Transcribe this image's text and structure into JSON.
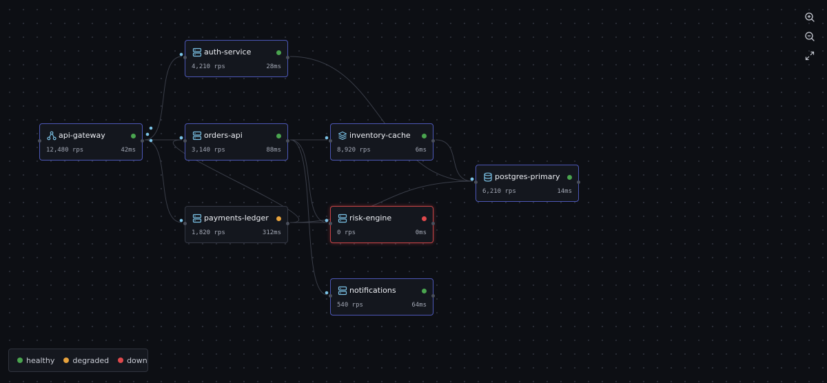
{
  "colors": {
    "healthy": "#4aa54f",
    "degraded": "#e8a33d",
    "down": "#e0494c",
    "accent": "#7cc4e8",
    "edge": "#3a3e49"
  },
  "nodes": [
    {
      "id": "auth-service",
      "name": "auth-service",
      "rps": "4,210 rps",
      "latency": "28ms",
      "status": "healthy",
      "icon": "server-icon",
      "selected": true
    },
    {
      "id": "api-gateway",
      "name": "api-gateway",
      "rps": "12,480 rps",
      "latency": "42ms",
      "status": "healthy",
      "icon": "network-icon",
      "selected": true
    },
    {
      "id": "orders-api",
      "name": "orders-api",
      "rps": "3,140 rps",
      "latency": "88ms",
      "status": "healthy",
      "icon": "server-icon",
      "selected": true
    },
    {
      "id": "inventory-cache",
      "name": "inventory-cache",
      "rps": "8,920 rps",
      "latency": "6ms",
      "status": "healthy",
      "icon": "layers-icon",
      "selected": true
    },
    {
      "id": "postgres-primary",
      "name": "postgres-primary",
      "rps": "6,210 rps",
      "latency": "14ms",
      "status": "healthy",
      "icon": "database-icon",
      "selected": true
    },
    {
      "id": "payments-ledger",
      "name": "payments-ledger",
      "rps": "1,820 rps",
      "latency": "312ms",
      "status": "degraded",
      "icon": "server-icon",
      "selected": false
    },
    {
      "id": "risk-engine",
      "name": "risk-engine",
      "rps": "0 rps",
      "latency": "0ms",
      "status": "down",
      "icon": "server-icon",
      "selected": false
    },
    {
      "id": "notifications",
      "name": "notifications",
      "rps": "540 rps",
      "latency": "64ms",
      "status": "healthy",
      "icon": "server-icon",
      "selected": true
    }
  ],
  "edges": [
    {
      "from": "api-gateway",
      "to": "auth-service"
    },
    {
      "from": "api-gateway",
      "to": "orders-api"
    },
    {
      "from": "api-gateway",
      "to": "payments-ledger"
    },
    {
      "from": "orders-api",
      "to": "inventory-cache"
    },
    {
      "from": "orders-api",
      "to": "notifications"
    },
    {
      "from": "orders-api",
      "to": "risk-engine"
    },
    {
      "from": "auth-service",
      "to": "postgres-primary"
    },
    {
      "from": "inventory-cache",
      "to": "postgres-primary"
    },
    {
      "from": "payments-ledger",
      "to": "postgres-primary"
    },
    {
      "from": "payments-ledger",
      "to": "risk-engine"
    },
    {
      "from": "payments-ledger",
      "to": "orders-api"
    }
  ],
  "legend": [
    {
      "label": "healthy",
      "status": "healthy"
    },
    {
      "label": "degraded",
      "status": "degraded"
    },
    {
      "label": "down",
      "status": "down"
    }
  ],
  "controls": [
    {
      "name": "zoom-in",
      "icon": "zoom-in-icon"
    },
    {
      "name": "zoom-out",
      "icon": "zoom-out-icon"
    },
    {
      "name": "fit-view",
      "icon": "fit-view-icon"
    }
  ]
}
